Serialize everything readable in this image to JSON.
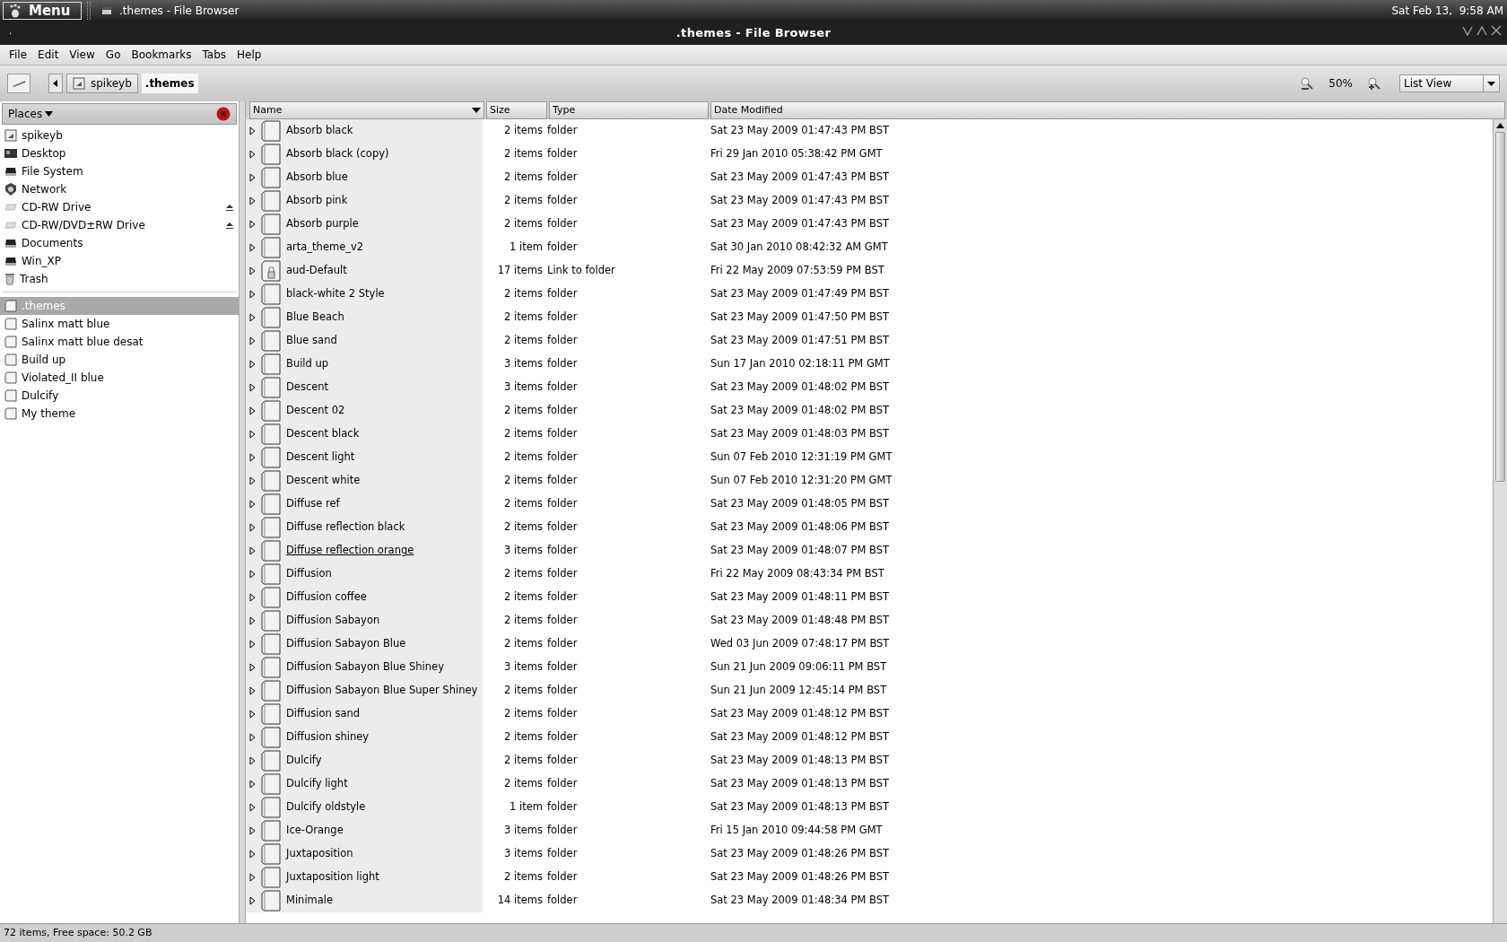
{
  "top_panel": {
    "menu_label": "Menu",
    "task": ".themes - File Browser",
    "clock": "Sat Feb 13,  9:58 AM"
  },
  "window": {
    "title": ".themes - File Browser",
    "small_label": "."
  },
  "menu": [
    "File",
    "Edit",
    "View",
    "Go",
    "Bookmarks",
    "Tabs",
    "Help"
  ],
  "path": [
    {
      "label": "spikeyb",
      "selected": false
    },
    {
      "label": ".themes",
      "selected": true
    }
  ],
  "zoom": {
    "label": "50%"
  },
  "view_select": {
    "value": "List View"
  },
  "places": {
    "title": "Places",
    "items": [
      {
        "label": "spikeyb",
        "kind": "home",
        "selected": false
      },
      {
        "label": "Desktop",
        "kind": "desktop",
        "selected": false
      },
      {
        "label": "File System",
        "kind": "drive",
        "selected": false
      },
      {
        "label": "Network",
        "kind": "network",
        "selected": false
      },
      {
        "label": "CD-RW Drive",
        "kind": "optical",
        "selected": false
      },
      {
        "label": "CD-RW/DVD±RW Drive",
        "kind": "optical",
        "selected": false
      },
      {
        "label": "Documents",
        "kind": "drive",
        "selected": false
      },
      {
        "label": "Win_XP",
        "kind": "drive",
        "selected": false
      },
      {
        "label": "Trash",
        "kind": "trash",
        "selected": false
      }
    ],
    "bookmarks": [
      {
        "label": ".themes",
        "kind": "folder",
        "selected": true
      },
      {
        "label": "Salinx matt blue",
        "kind": "folder",
        "selected": false
      },
      {
        "label": "Salinx matt blue desat",
        "kind": "folder",
        "selected": false
      },
      {
        "label": "Build up",
        "kind": "folder",
        "selected": false
      },
      {
        "label": "Violated_II blue",
        "kind": "folder",
        "selected": false
      },
      {
        "label": "Dulcify",
        "kind": "folder",
        "selected": false
      },
      {
        "label": "My theme",
        "kind": "folder",
        "selected": false
      }
    ]
  },
  "table": {
    "columns": [
      "Name",
      "Size",
      "Type",
      "Date Modified"
    ],
    "rows": [
      {
        "name": "Absorb black",
        "size": "2 items",
        "type": "folder",
        "date": "Sat 23 May 2009 01:47:43 PM BST",
        "kind": "folder",
        "hovered": false
      },
      {
        "name": "Absorb black (copy)",
        "size": "2 items",
        "type": "folder",
        "date": "Fri 29 Jan 2010 05:38:42 PM GMT",
        "kind": "folder",
        "hovered": false
      },
      {
        "name": "Absorb blue",
        "size": "2 items",
        "type": "folder",
        "date": "Sat 23 May 2009 01:47:43 PM BST",
        "kind": "folder",
        "hovered": false
      },
      {
        "name": "Absorb pink",
        "size": "2 items",
        "type": "folder",
        "date": "Sat 23 May 2009 01:47:43 PM BST",
        "kind": "folder",
        "hovered": false
      },
      {
        "name": "Absorb purple",
        "size": "2 items",
        "type": "folder",
        "date": "Sat 23 May 2009 01:47:43 PM BST",
        "kind": "folder",
        "hovered": false
      },
      {
        "name": "arta_theme_v2",
        "size": "1 item",
        "type": "folder",
        "date": "Sat 30 Jan 2010 08:42:32 AM GMT",
        "kind": "folder",
        "hovered": false
      },
      {
        "name": "aud-Default",
        "size": "17 items",
        "type": "Link to folder",
        "date": "Fri 22 May 2009 07:53:59 PM BST",
        "kind": "link",
        "hovered": false
      },
      {
        "name": "black-white 2 Style",
        "size": "2 items",
        "type": "folder",
        "date": "Sat 23 May 2009 01:47:49 PM BST",
        "kind": "folder",
        "hovered": false
      },
      {
        "name": "Blue Beach",
        "size": "2 items",
        "type": "folder",
        "date": "Sat 23 May 2009 01:47:50 PM BST",
        "kind": "folder",
        "hovered": false
      },
      {
        "name": "Blue sand",
        "size": "2 items",
        "type": "folder",
        "date": "Sat 23 May 2009 01:47:51 PM BST",
        "kind": "folder",
        "hovered": false
      },
      {
        "name": "Build up",
        "size": "3 items",
        "type": "folder",
        "date": "Sun 17 Jan 2010 02:18:11 PM GMT",
        "kind": "folder",
        "hovered": false
      },
      {
        "name": "Descent",
        "size": "3 items",
        "type": "folder",
        "date": "Sat 23 May 2009 01:48:02 PM BST",
        "kind": "folder",
        "hovered": false
      },
      {
        "name": "Descent 02",
        "size": "2 items",
        "type": "folder",
        "date": "Sat 23 May 2009 01:48:02 PM BST",
        "kind": "folder",
        "hovered": false
      },
      {
        "name": "Descent black",
        "size": "2 items",
        "type": "folder",
        "date": "Sat 23 May 2009 01:48:03 PM BST",
        "kind": "folder",
        "hovered": false
      },
      {
        "name": "Descent light",
        "size": "2 items",
        "type": "folder",
        "date": "Sun 07 Feb 2010 12:31:19 PM GMT",
        "kind": "folder",
        "hovered": false
      },
      {
        "name": "Descent white",
        "size": "2 items",
        "type": "folder",
        "date": "Sun 07 Feb 2010 12:31:20 PM GMT",
        "kind": "folder",
        "hovered": false
      },
      {
        "name": "Diffuse ref",
        "size": "2 items",
        "type": "folder",
        "date": "Sat 23 May 2009 01:48:05 PM BST",
        "kind": "folder",
        "hovered": false
      },
      {
        "name": "Diffuse reflection black",
        "size": "2 items",
        "type": "folder",
        "date": "Sat 23 May 2009 01:48:06 PM BST",
        "kind": "folder",
        "hovered": false
      },
      {
        "name": "Diffuse reflection orange",
        "size": "3 items",
        "type": "folder",
        "date": "Sat 23 May 2009 01:48:07 PM BST",
        "kind": "folder",
        "hovered": true
      },
      {
        "name": "Diffusion",
        "size": "2 items",
        "type": "folder",
        "date": "Fri 22 May 2009 08:43:34 PM BST",
        "kind": "folder",
        "hovered": false
      },
      {
        "name": "Diffusion coffee",
        "size": "2 items",
        "type": "folder",
        "date": "Sat 23 May 2009 01:48:11 PM BST",
        "kind": "folder",
        "hovered": false
      },
      {
        "name": "Diffusion Sabayon",
        "size": "2 items",
        "type": "folder",
        "date": "Sat 23 May 2009 01:48:48 PM BST",
        "kind": "folder",
        "hovered": false
      },
      {
        "name": "Diffusion Sabayon Blue",
        "size": "2 items",
        "type": "folder",
        "date": "Wed 03 Jun 2009 07:48:17 PM BST",
        "kind": "folder",
        "hovered": false
      },
      {
        "name": "Diffusion Sabayon Blue Shiney",
        "size": "3 items",
        "type": "folder",
        "date": "Sun 21 Jun 2009 09:06:11 PM BST",
        "kind": "folder",
        "hovered": false
      },
      {
        "name": "Diffusion Sabayon Blue Super Shiney",
        "size": "2 items",
        "type": "folder",
        "date": "Sun 21 Jun 2009 12:45:14 PM BST",
        "kind": "folder",
        "hovered": false
      },
      {
        "name": "Diffusion sand",
        "size": "2 items",
        "type": "folder",
        "date": "Sat 23 May 2009 01:48:12 PM BST",
        "kind": "folder",
        "hovered": false
      },
      {
        "name": "Diffusion shiney",
        "size": "2 items",
        "type": "folder",
        "date": "Sat 23 May 2009 01:48:12 PM BST",
        "kind": "folder",
        "hovered": false
      },
      {
        "name": "Dulcify",
        "size": "2 items",
        "type": "folder",
        "date": "Sat 23 May 2009 01:48:13 PM BST",
        "kind": "folder",
        "hovered": false
      },
      {
        "name": "Dulcify light",
        "size": "2 items",
        "type": "folder",
        "date": "Sat 23 May 2009 01:48:13 PM BST",
        "kind": "folder",
        "hovered": false
      },
      {
        "name": "Dulcify oldstyle",
        "size": "1 item",
        "type": "folder",
        "date": "Sat 23 May 2009 01:48:13 PM BST",
        "kind": "folder",
        "hovered": false
      },
      {
        "name": "Ice-Orange",
        "size": "3 items",
        "type": "folder",
        "date": "Fri 15 Jan 2010 09:44:58 PM GMT",
        "kind": "folder",
        "hovered": false
      },
      {
        "name": "Juxtaposition",
        "size": "3 items",
        "type": "folder",
        "date": "Sat 23 May 2009 01:48:26 PM BST",
        "kind": "folder",
        "hovered": false
      },
      {
        "name": "Juxtaposition light",
        "size": "2 items",
        "type": "folder",
        "date": "Sat 23 May 2009 01:48:26 PM BST",
        "kind": "folder",
        "hovered": false
      },
      {
        "name": "Minimale",
        "size": "14 items",
        "type": "folder",
        "date": "Sat 23 May 2009 01:48:34 PM BST",
        "kind": "folder",
        "hovered": false
      }
    ]
  },
  "status_bar": "72 items, Free space: 50.2 GB"
}
